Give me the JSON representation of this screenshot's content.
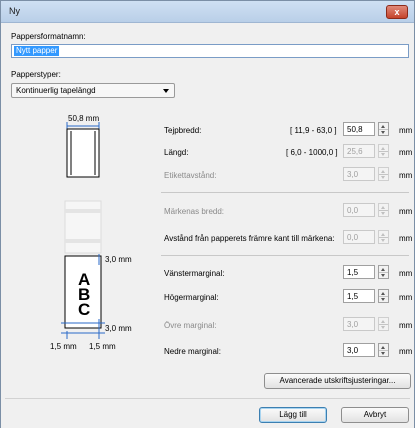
{
  "window": {
    "title": "Ny",
    "close_label": "x"
  },
  "name_section": {
    "label": "Pappersformatnamn:",
    "value": "Nytt papper"
  },
  "type_section": {
    "label": "Papperstyper:",
    "selected": "Kontinuerlig tapelängd"
  },
  "preview": {
    "top_width": "50,8 mm",
    "margin_top": "3,0 mm",
    "margin_bottom": "3,0 mm",
    "margin_left": "1,5 mm",
    "margin_right": "1,5 mm",
    "letters": [
      "A",
      "B",
      "C"
    ]
  },
  "tape": {
    "width_label": "Tejpbredd:",
    "width_range": "[ 11,9 - 63,0 ]",
    "width_value": "50,8",
    "length_label": "Längd:",
    "length_range": "[ 6,0 - 1000,0 ]",
    "length_value": "25,6",
    "gap_label": "Etikettavstånd:",
    "gap_value": "3,0"
  },
  "marks": {
    "width_label": "Märkenas bredd:",
    "width_value": "0,0",
    "distance_label": "Avstånd från papperets främre kant till märkena:",
    "distance_value": "0,0"
  },
  "margins": {
    "left_label": "Vänstermarginal:",
    "left_value": "1,5",
    "right_label": "Högermarginal:",
    "right_value": "1,5",
    "top_label": "Övre marginal:",
    "top_value": "3,0",
    "bottom_label": "Nedre marginal:",
    "bottom_value": "3,0"
  },
  "unit": "mm",
  "buttons": {
    "advanced": "Avancerade utskriftsjusteringar...",
    "add": "Lägg till",
    "cancel": "Avbryt"
  }
}
